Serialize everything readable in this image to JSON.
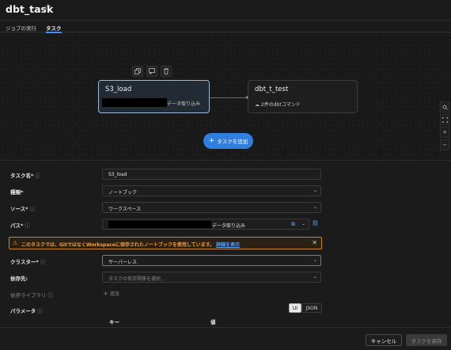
{
  "header": {
    "title": "dbt_task",
    "star_icon": "star-outline-icon"
  },
  "tabs": [
    {
      "label": "ジョブの実行",
      "active": false
    },
    {
      "label": "タスク",
      "active": true
    }
  ],
  "dag": {
    "toolbar_icons": [
      "copy-icon",
      "comment-icon",
      "trash-icon"
    ],
    "nodes": [
      {
        "title": "S3_load",
        "subtitle": "データ取り込み",
        "selected": true
      },
      {
        "title": "dbt_t_test",
        "subtitle": "2件のdbtコマンド",
        "subtitle_icon": "cloud-icon"
      }
    ],
    "add_task_label": "タスクを追加",
    "side_tools": [
      "search-icon",
      "fit-icon",
      "zoom-in-icon",
      "zoom-out-icon"
    ]
  },
  "form": {
    "task_name": {
      "label": "タスク名*",
      "value": "S3_load"
    },
    "type": {
      "label": "種類*",
      "value": "ノートブック"
    },
    "source": {
      "label": "ソース*",
      "value": "ワークスペース"
    },
    "path": {
      "label": "パス*",
      "value": "データ取り込み"
    },
    "warning": {
      "text": "このタスクでは、GitではなくWorkspaceに保存されたノートブックを使用しています。",
      "link": "詳細を表示"
    },
    "cluster": {
      "label": "クラスター*",
      "value": "サーバーレス"
    },
    "depends_on": {
      "label": "依存先:",
      "placeholder": "タスクの依存関係を選択..."
    },
    "libraries": {
      "label": "依存ライブラリ",
      "add_label": "追加"
    },
    "parameters": {
      "label": "パラメータ",
      "toggle": [
        "UI",
        "JSON"
      ],
      "active_toggle": "UI",
      "columns": [
        "キー",
        "値"
      ]
    }
  },
  "footer": {
    "cancel_label": "キャンセル",
    "save_label": "タスクを保存"
  },
  "colors": {
    "accent": "#2f7fe0",
    "warning": "#f0a13c",
    "link": "#5aa3ff"
  }
}
